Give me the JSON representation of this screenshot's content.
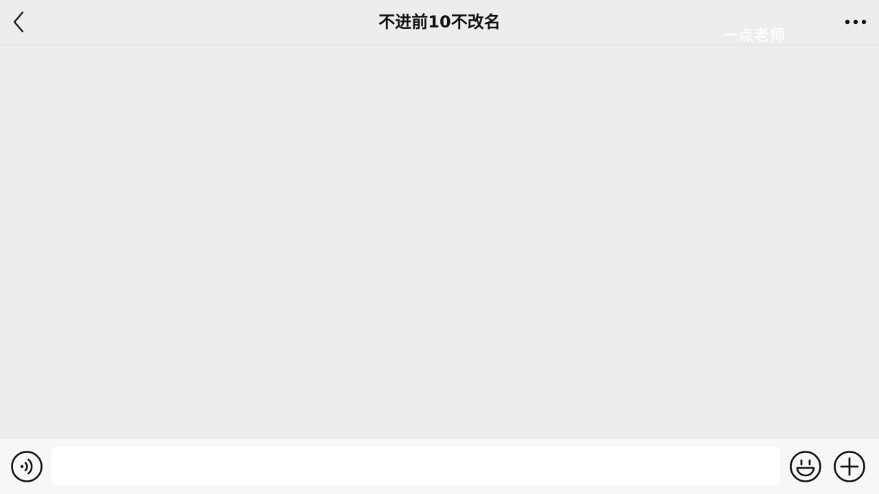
{
  "header": {
    "title": "不进前10不改名",
    "back_icon": "chevron-left-icon",
    "more_icon": "more-dots-icon"
  },
  "watermark": {
    "text": "一点老师"
  },
  "input_bar": {
    "voice_icon": "voice-icon",
    "message_value": "",
    "emoji_icon": "emoji-icon",
    "plus_icon": "plus-icon"
  },
  "colors": {
    "background": "#ededed",
    "input_bar_bg": "#f7f7f7",
    "icon_stroke": "#111111"
  }
}
